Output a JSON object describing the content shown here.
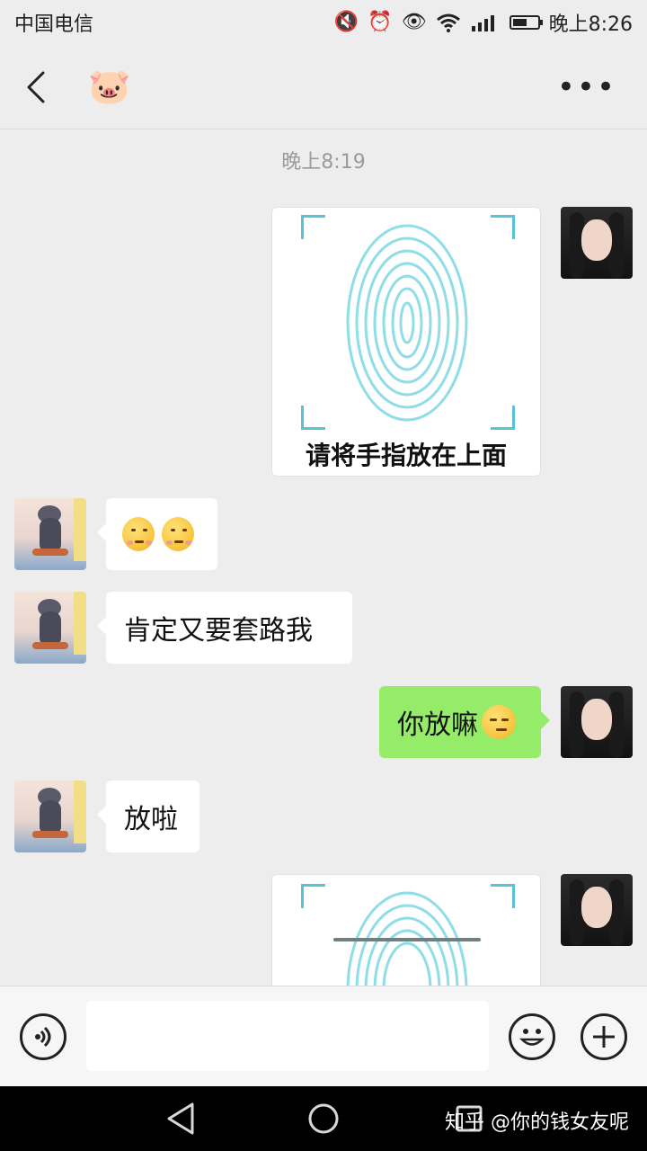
{
  "status_bar": {
    "carrier": "中国电信",
    "time": "晚上8:26",
    "network": "4G 2G"
  },
  "top_bar": {
    "contact_avatar_emoji": "🐷",
    "more_label": "•••"
  },
  "chat": {
    "timestamp": "晚上8:19",
    "messages": [
      {
        "side": "right",
        "type": "image",
        "caption": "请将手指放在上面"
      },
      {
        "side": "left",
        "type": "emoji",
        "text": ""
      },
      {
        "side": "left",
        "type": "text",
        "text": "肯定又要套路我"
      },
      {
        "side": "right",
        "type": "text",
        "text": "你放嘛"
      },
      {
        "side": "left",
        "type": "text",
        "text": "放啦"
      },
      {
        "side": "right",
        "type": "image",
        "caption": ""
      }
    ]
  },
  "input_bar": {
    "voice_icon": "voice-icon",
    "emoji_icon": "emoji-icon",
    "plus_icon": "plus-icon"
  },
  "watermark": "知乎 @你的钱女友呢",
  "colors": {
    "background": "#ededed",
    "bubble_self": "#95ec69",
    "bubble_other": "#ffffff",
    "fingerprint": "#8fdde6"
  }
}
